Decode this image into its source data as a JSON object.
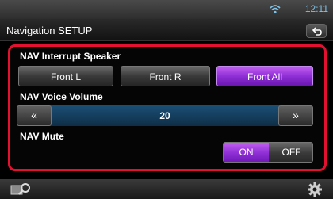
{
  "status": {
    "time": "12:11"
  },
  "header": {
    "title": "Navigation SETUP"
  },
  "speaker": {
    "label": "NAV Interrupt Speaker",
    "options": [
      "Front L",
      "Front R",
      "Front All"
    ],
    "selected": "Front All"
  },
  "volume": {
    "label": "NAV Voice Volume",
    "value": "20",
    "decrease_label": "«",
    "increase_label": "»"
  },
  "mute": {
    "label": "NAV Mute",
    "on_label": "ON",
    "off_label": "OFF",
    "selected": "ON"
  },
  "colors": {
    "accent": "#8f2fd6",
    "highlight_border": "#e3102f",
    "time": "#7ec3ea"
  },
  "icons": {
    "status": "wifi-icon",
    "back": "back-arrow-icon",
    "search": "search-icon",
    "settings": "gear-icon"
  }
}
